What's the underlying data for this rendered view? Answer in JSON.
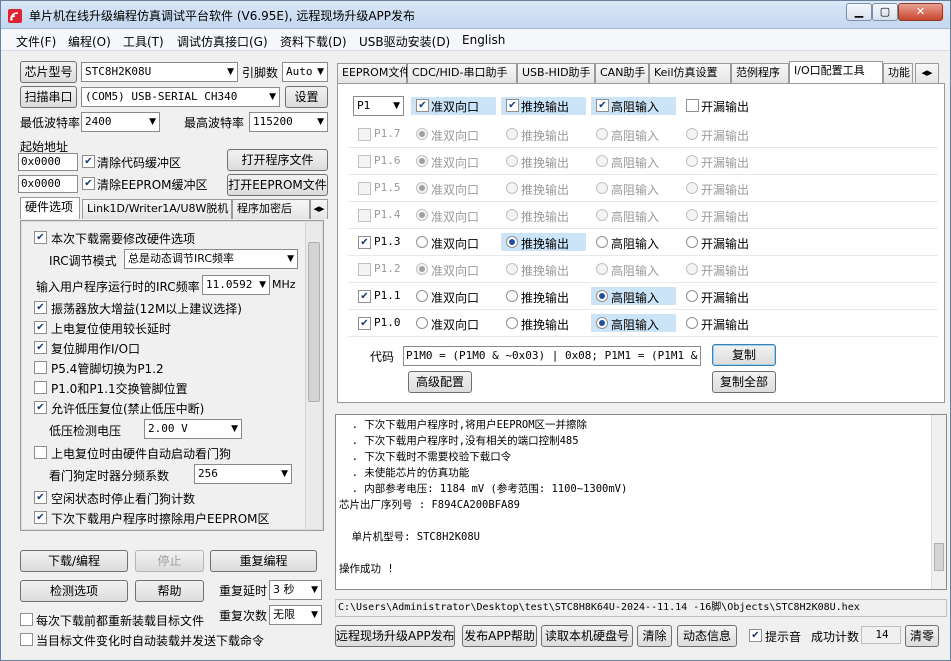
{
  "window": {
    "title": "单片机在线升级编程仿真调试平台软件 (V6.95E), 远程现场升级APP发布"
  },
  "menu": [
    "文件(F)",
    "编程(O)",
    "工具(T)",
    "调试仿真接口(G)",
    "资料下载(D)",
    "USB驱动安装(D)",
    "English"
  ],
  "left": {
    "chip_btn": "芯片型号",
    "chip_val": "STC8H2K08U",
    "pins_label": "引脚数",
    "pins_val": "Auto",
    "scan_btn": "扫描串口",
    "port_val": "(COM5) USB-SERIAL CH340",
    "settings_btn": "设置",
    "min_baud_label": "最低波特率",
    "min_baud_val": "2400",
    "max_baud_label": "最高波特率",
    "max_baud_val": "115200",
    "start_addr_label": "起始地址",
    "addr1": "0x0000",
    "clear_code": "清除代码缓冲区",
    "open_prog": "打开程序文件",
    "addr2": "0x0000",
    "clear_eeprom": "清除EEPROM缓冲区",
    "open_eeprom": "打开EEPROM文件",
    "tabs": [
      "硬件选项",
      "Link1D/Writer1A/U8W脱机",
      "程序加密后"
    ],
    "opts": {
      "o1": "本次下载需要修改硬件选项",
      "irc_mode_label": "IRC调节模式",
      "irc_mode_val": "总是动态调节IRC频率",
      "irc_freq_label": "输入用户程序运行时的IRC频率",
      "irc_freq_val": "11.0592",
      "irc_unit": "MHz",
      "o2": "振荡器放大增益(12M以上建议选择)",
      "o3": "上电复位使用较长延时",
      "o4": "复位脚用作I/O口",
      "o5": "P5.4管脚切换为P1.2",
      "o6": "P1.0和P1.1交换管脚位置",
      "o7": "允许低压复位(禁止低压中断)",
      "lvd_label": "低压检测电压",
      "lvd_val": "2.00 V",
      "o8": "上电复位时由硬件自动启动看门狗",
      "wdt_label": "看门狗定时器分频系数",
      "wdt_val": "256",
      "o9": "空闲状态时停止看门狗计数",
      "o10": "下次下载用户程序时擦除用户EEPROM区"
    },
    "download_btn": "下载/编程",
    "stop_btn": "停止",
    "reprog_btn": "重复编程",
    "detect_btn": "检测选项",
    "help_btn": "帮助",
    "repeat_delay_label": "重复延时",
    "repeat_delay_val": "3 秒",
    "repeat_count_label": "重复次数",
    "repeat_count_val": "无限",
    "reload_each": "每次下载前都重新装载目标文件",
    "auto_send": "当目标文件变化时自动装载并发送下载命令"
  },
  "right": {
    "tabs": [
      "EEPROM文件",
      "CDC/HID-串口助手",
      "USB-HID助手",
      "CAN助手",
      "Keil仿真设置",
      "范例程序",
      "I/O口配置工具",
      "功能"
    ],
    "port_sel": "P1",
    "hdr": {
      "quasi": "准双向口",
      "push": "推挽输出",
      "hiz": "高阻输入",
      "od": "开漏输出"
    },
    "pins": [
      {
        "name": "P1.7",
        "on": false,
        "mode": "quasi"
      },
      {
        "name": "P1.6",
        "on": false,
        "mode": "quasi"
      },
      {
        "name": "P1.5",
        "on": false,
        "mode": "quasi"
      },
      {
        "name": "P1.4",
        "on": false,
        "mode": "quasi"
      },
      {
        "name": "P1.3",
        "on": true,
        "mode": "push"
      },
      {
        "name": "P1.2",
        "on": false,
        "mode": "quasi"
      },
      {
        "name": "P1.1",
        "on": true,
        "mode": "hiz"
      },
      {
        "name": "P1.0",
        "on": true,
        "mode": "hiz"
      }
    ],
    "code_label": "代码",
    "code_val": "P1M0 = (P1M0 & ~0x03) | 0x08; P1M1 = (P1M1 & ~0x",
    "copy_btn": "复制",
    "adv_btn": "高级配置",
    "copy_all_btn": "复制全部",
    "log": [
      "  . 下次下载用户程序时,将用户EEPROM区一并擦除",
      "  . 下次下载用户程序时,没有相关的端口控制485",
      "  . 下次下载时不需要校验下载口令",
      "  . 未使能芯片的仿真功能",
      "  . 内部参考电压: 1184 mV (参考范围: 1100~1300mV)",
      "芯片出厂序列号 : F894CA200BFA89",
      "",
      "  单片机型号: STC8H2K08U",
      "",
      "操作成功 !"
    ],
    "path": "C:\\Users\\Administrator\\Desktop\\test\\STC8H8K64U-2024--11.14 -16脚\\Objects\\STC8H2K08U.hex",
    "btm": {
      "publish": "远程现场升级APP发布",
      "publish_help": "发布APP帮助",
      "read_hdd": "读取本机硬盘号",
      "clear": "清除",
      "anim": "动态信息",
      "beep": "提示音",
      "count_label": "成功计数",
      "count_val": "14",
      "reset": "清零"
    }
  }
}
